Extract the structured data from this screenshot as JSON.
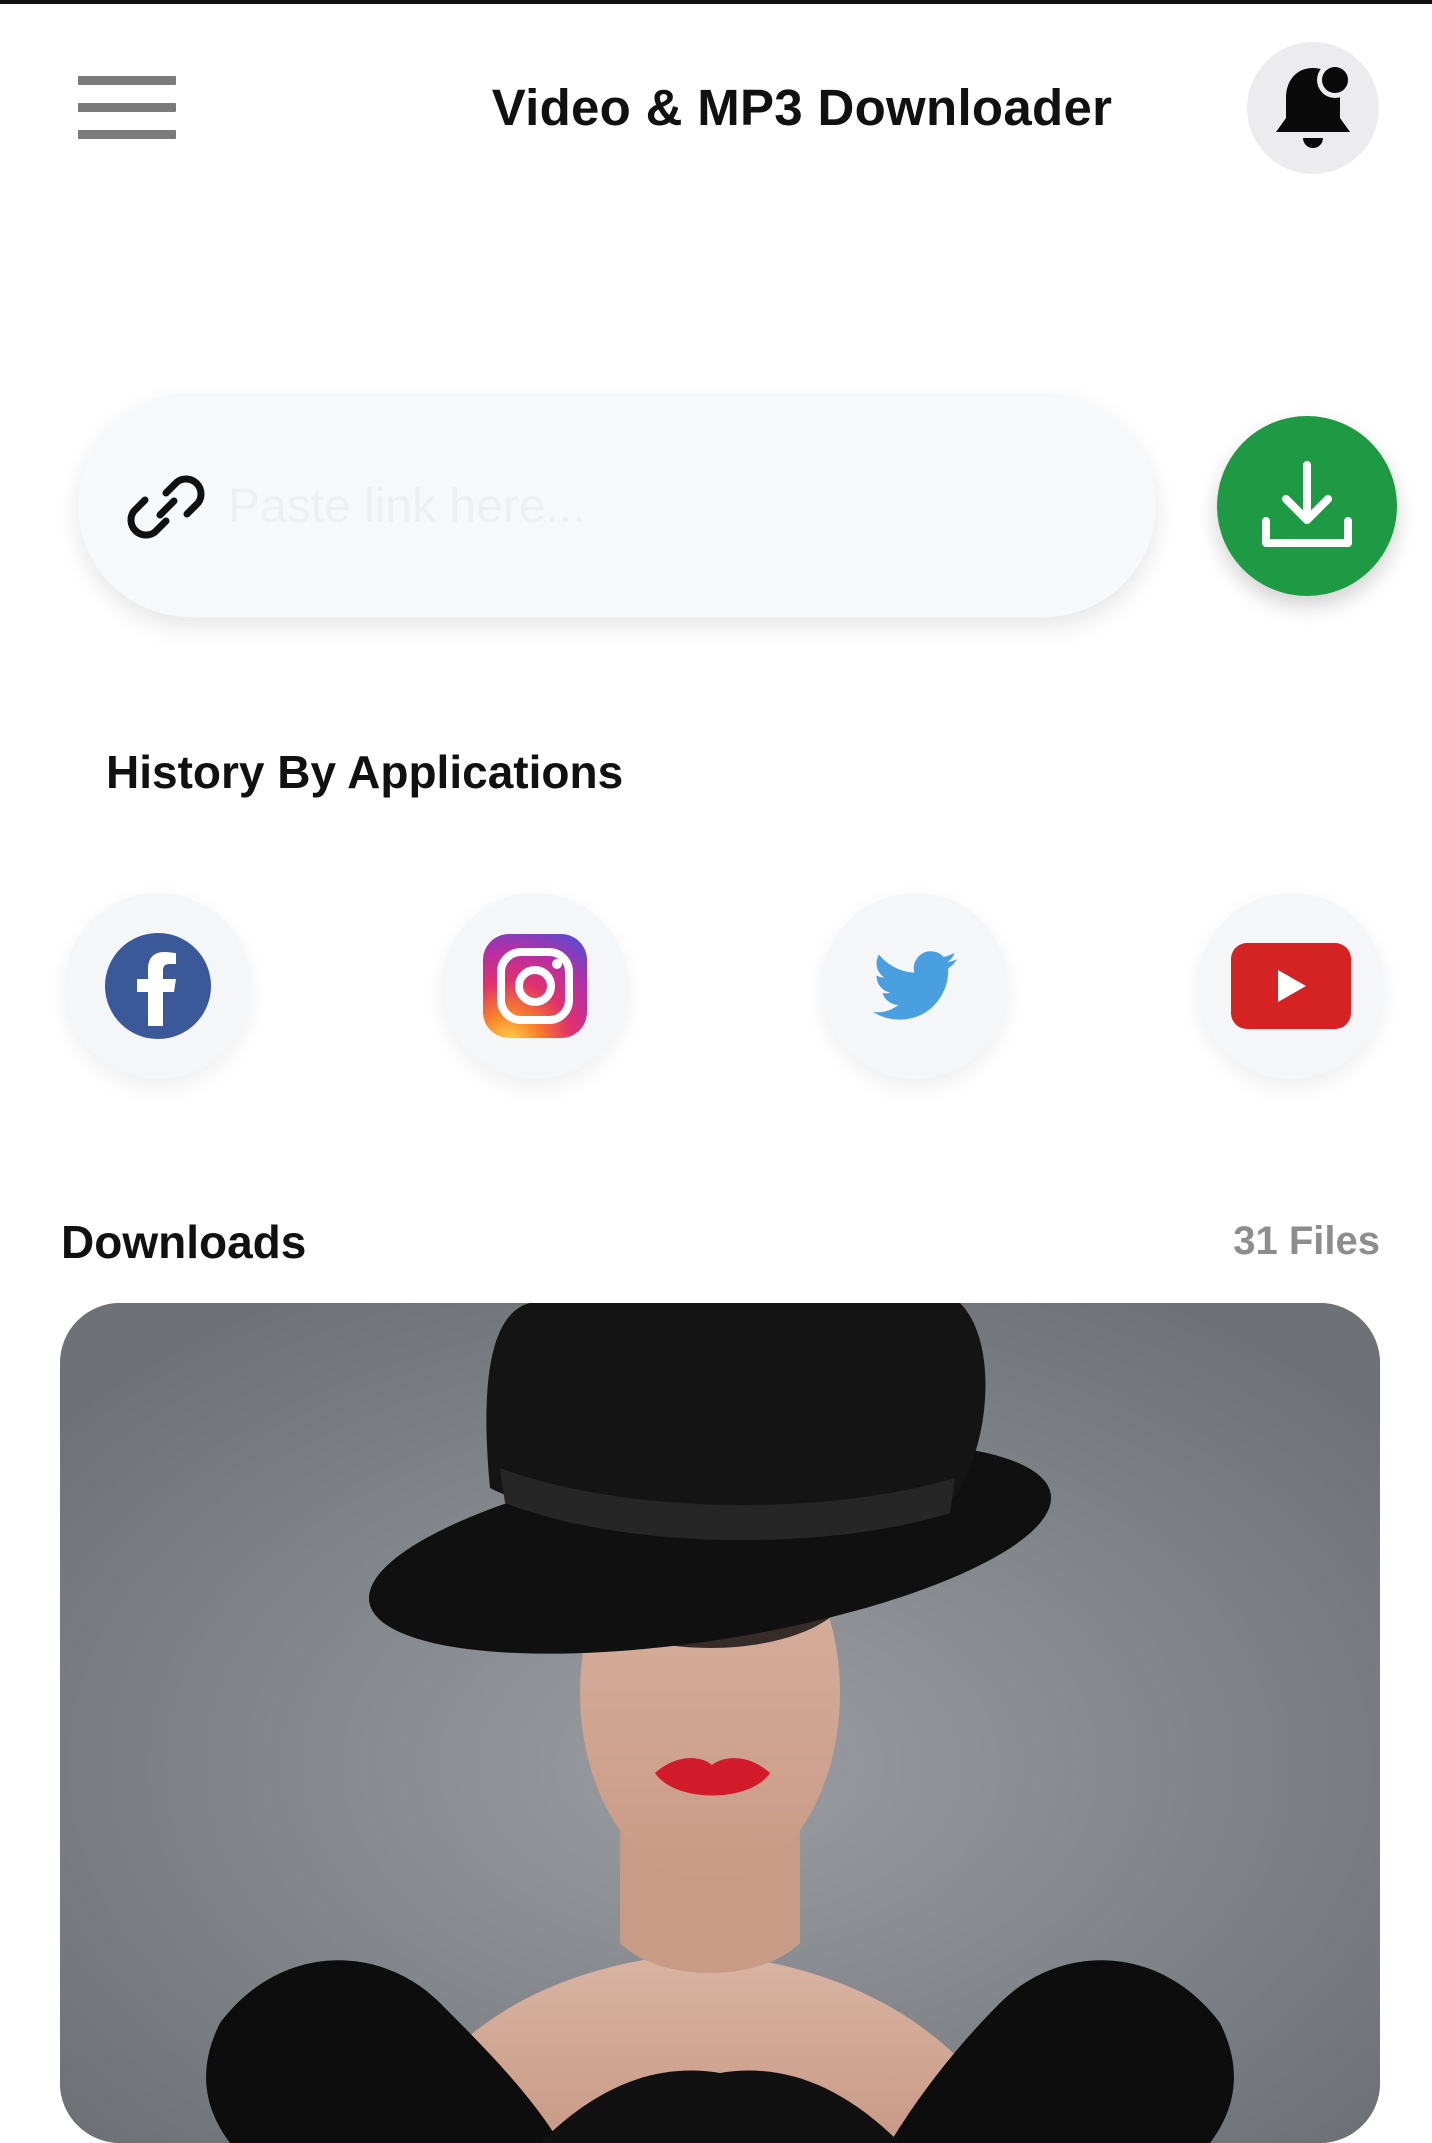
{
  "header": {
    "title": "Video & MP3 Downloader",
    "menu_icon": "hamburger-menu-icon",
    "notification_icon": "bell-notification-icon"
  },
  "link_input": {
    "placeholder": "Paste link here...",
    "value": "",
    "icon": "link-icon"
  },
  "download_button": {
    "icon": "download-icon",
    "color": "#1f9a44"
  },
  "history": {
    "title": "History By Applications",
    "apps": [
      {
        "name": "Facebook",
        "icon": "facebook-icon",
        "color": "#3b5998"
      },
      {
        "name": "Instagram",
        "icon": "instagram-icon",
        "color": "#e1306c"
      },
      {
        "name": "Twitter",
        "icon": "twitter-icon",
        "color": "#4a9fe0"
      },
      {
        "name": "YouTube",
        "icon": "youtube-icon",
        "color": "#d52323"
      }
    ]
  },
  "downloads": {
    "title": "Downloads",
    "count_label": "31 Files",
    "items": [
      {
        "thumbnail": "woman-in-black-hat-thumbnail"
      }
    ]
  }
}
